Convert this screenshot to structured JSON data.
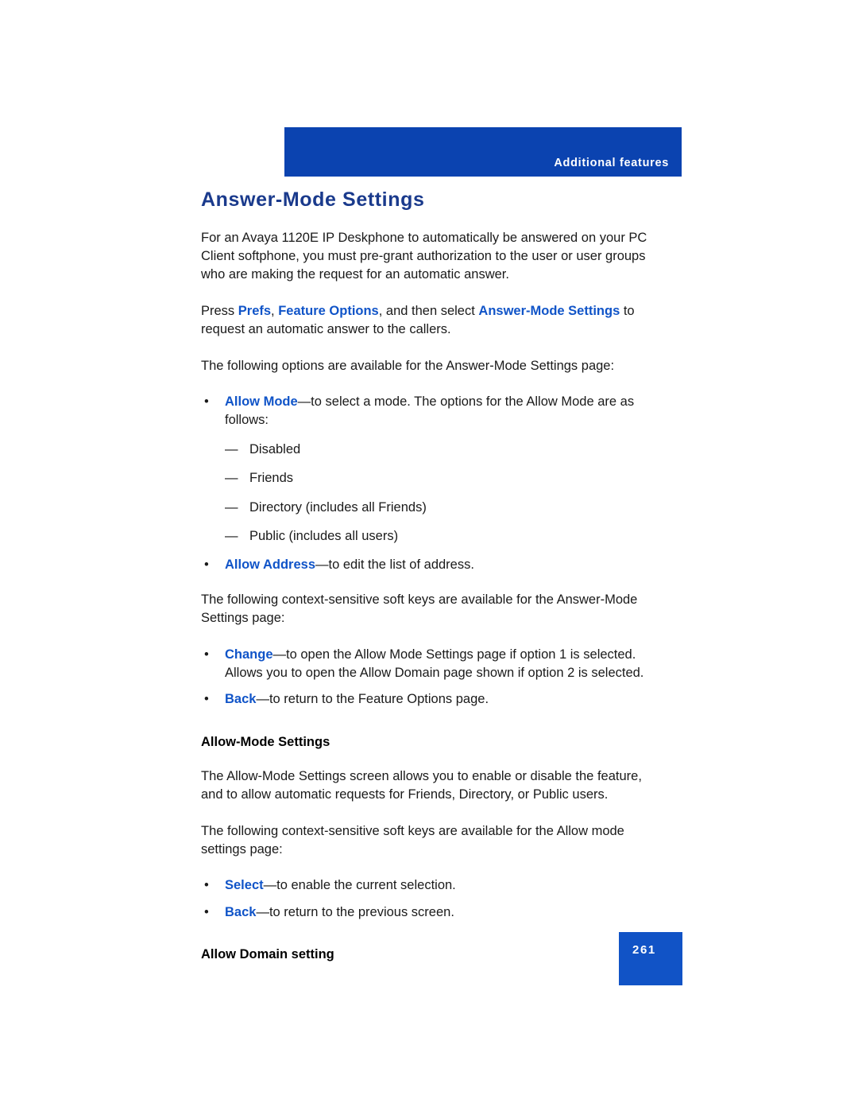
{
  "header": {
    "running_head": "Additional features",
    "bar_color": "#0b43b0"
  },
  "footer": {
    "page_number": "261",
    "box_color": "#1153c6"
  },
  "colors": {
    "heading_blue": "#1a3a8c",
    "inline_blue": "#1054c8",
    "body_black": "#1a1a1a"
  },
  "main": {
    "title": "Answer-Mode Settings",
    "paragraph_1": "For an Avaya 1120E IP Deskphone to automatically be answered on your PC Client softphone, you must pre-grant authorization to the user or user groups who are making the request for an automatic answer.",
    "paragraph_2": {
      "part_1": "Press ",
      "ref_1": "Prefs",
      "part_2": ", ",
      "ref_2": "Feature Options",
      "part_3": ", and then select ",
      "ref_3": "Answer-Mode Settings",
      "part_4": " to request an automatic answer to the callers."
    },
    "paragraph_3": "The following options are available for the Answer-Mode Settings page:",
    "options_list": [
      {
        "lead": "Allow Mode",
        "text": "—to select a mode. The options for the Allow Mode are as follows:",
        "sub_items": [
          "Disabled",
          "Friends",
          "Directory (includes all Friends)",
          "Public (includes all users)"
        ]
      },
      {
        "lead": "Allow Address",
        "text": "—to edit the list of address.",
        "sub_items": []
      }
    ],
    "paragraph_4": "The following context-sensitive soft keys are available for the Answer-Mode Settings page:",
    "softkeys_list_1": [
      {
        "lead": "Change",
        "text": "—to open the Allow Mode Settings page if option 1 is selected. Allows you to open the Allow Domain page shown if option 2 is selected."
      },
      {
        "lead": "Back",
        "text": "—to return to the Feature Options page."
      }
    ],
    "subhead_1": "Allow-Mode Settings",
    "paragraph_5": "The Allow-Mode Settings screen allows you to enable or disable the feature, and to allow automatic requests for Friends, Directory, or Public users.",
    "paragraph_6": "The following context-sensitive soft keys are available for the Allow mode settings page:",
    "softkeys_list_2": [
      {
        "lead": "Select",
        "text": "—to enable the current selection."
      },
      {
        "lead": "Back",
        "text": "—to return to the previous screen."
      }
    ],
    "subhead_2": "Allow Domain setting",
    "bullet_glyph": "•",
    "dash_glyph": "—"
  }
}
